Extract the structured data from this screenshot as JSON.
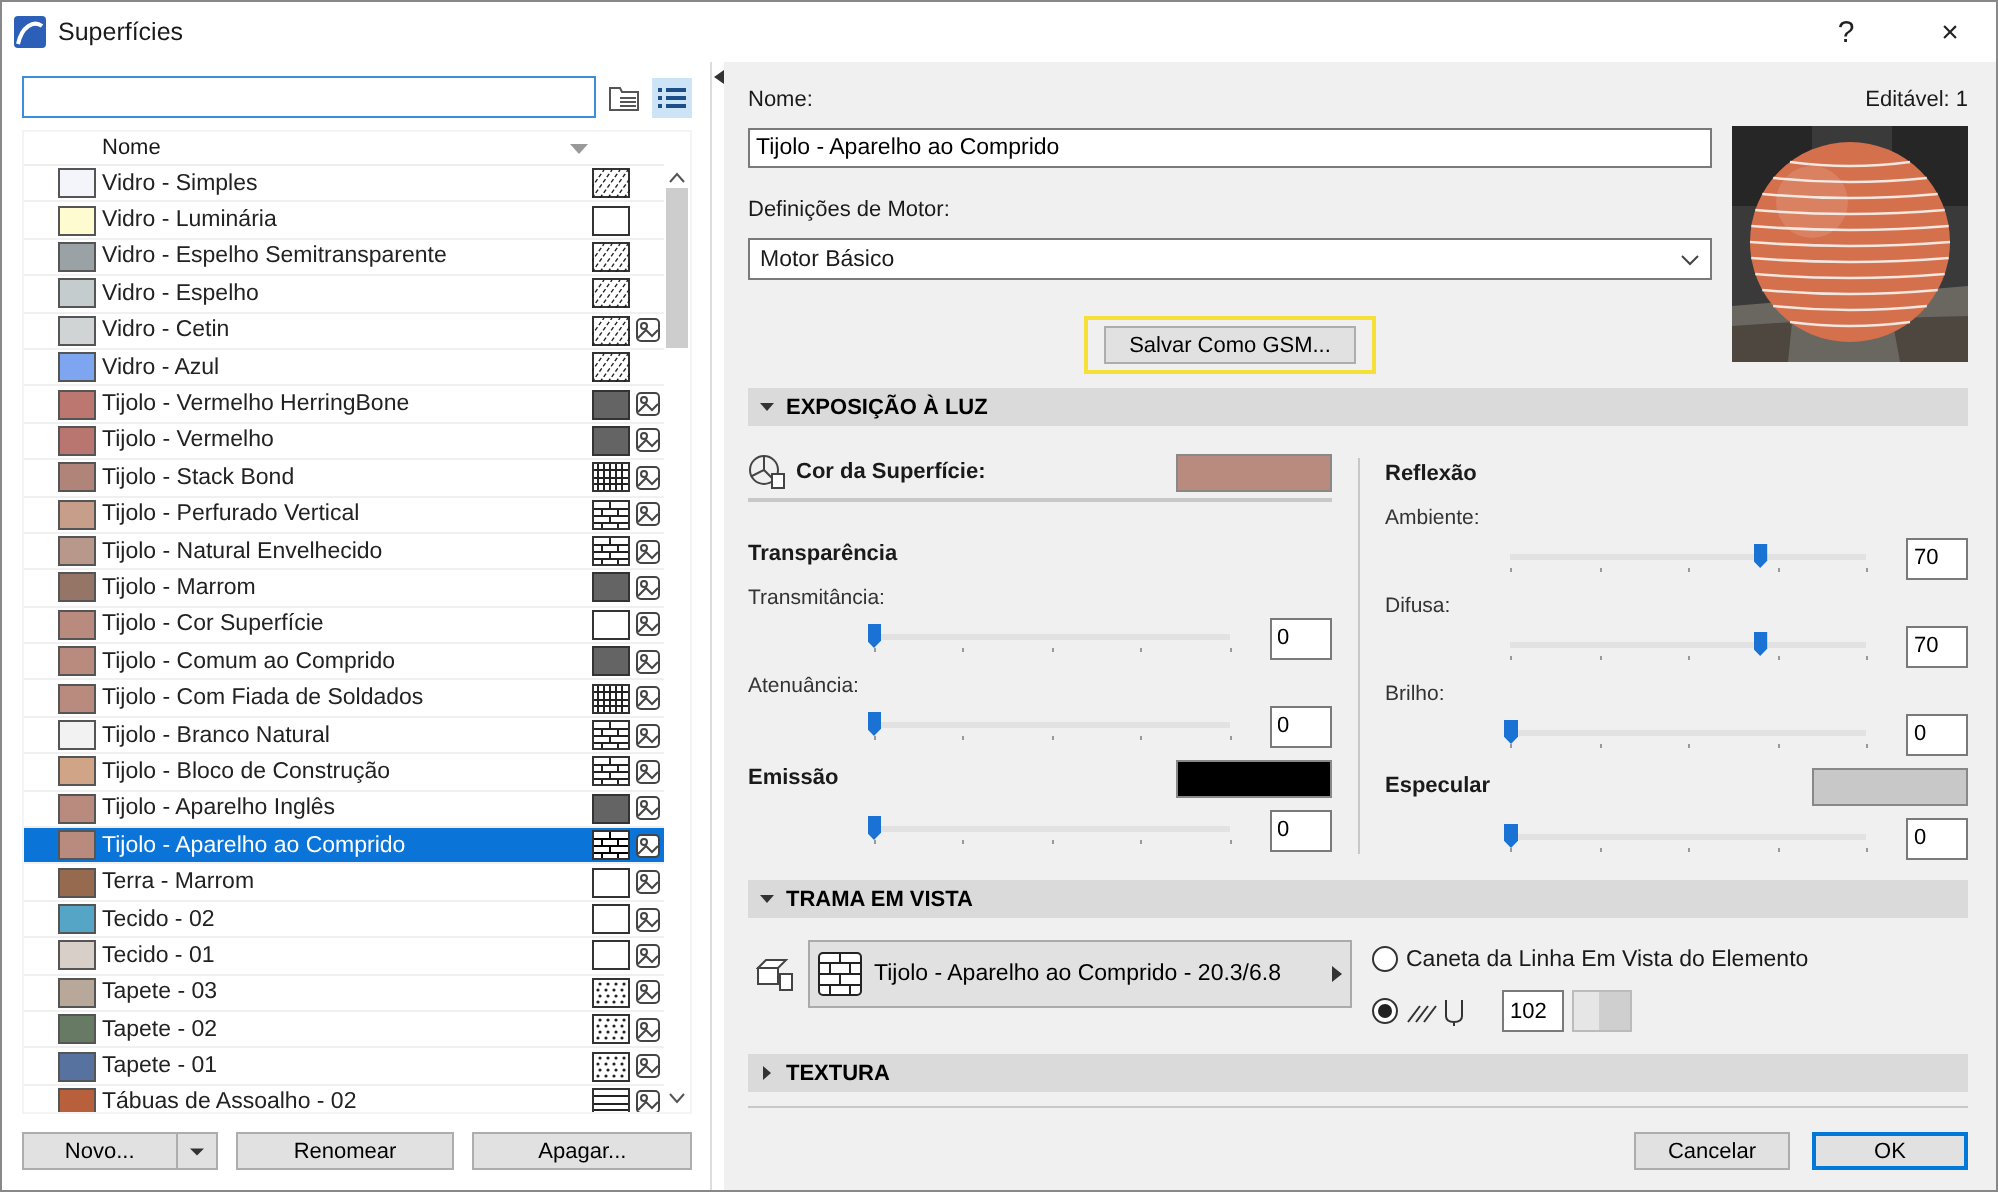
{
  "window": {
    "title": "Superfícies",
    "buttons": [
      "?",
      "×"
    ]
  },
  "library": {
    "view_buttons": [
      {
        "kind": "folder",
        "selected": false
      },
      {
        "kind": "list",
        "selected": true
      }
    ],
    "column": "Nome",
    "rows": [
      {
        "name": "Vidro - Simples",
        "color": "#f4f4fb",
        "kind": "diagonal",
        "texture": false,
        "selected": false
      },
      {
        "name": "Vidro - Luminária",
        "color": "#fffbd0",
        "kind": "blank",
        "texture": false,
        "selected": false
      },
      {
        "name": "Vidro - Espelho Semitransparente",
        "color": "#9aa2a6",
        "kind": "diagonal",
        "texture": false,
        "selected": false
      },
      {
        "name": "Vidro - Espelho",
        "color": "#c5ccce",
        "kind": "diagonal",
        "texture": false,
        "selected": false
      },
      {
        "name": "Vidro - Cetin",
        "color": "#d0d4d4",
        "kind": "diagonal",
        "texture": true,
        "selected": false
      },
      {
        "name": "Vidro - Azul",
        "color": "#7ea5ef",
        "kind": "diagonal",
        "texture": false,
        "selected": false
      },
      {
        "name": "Tijolo - Vermelho HerringBone",
        "color": "#bc7770",
        "kind": "dense",
        "texture": true,
        "selected": false
      },
      {
        "name": "Tijolo - Vermelho",
        "color": "#b97670",
        "kind": "dense",
        "texture": true,
        "selected": false
      },
      {
        "name": "Tijolo - Stack Bond",
        "color": "#b08478",
        "kind": "grid",
        "texture": true,
        "selected": false
      },
      {
        "name": "Tijolo - Perfurado Vertical",
        "color": "#c69e8a",
        "kind": "brick",
        "texture": true,
        "selected": false
      },
      {
        "name": "Tijolo - Natural Envelhecido",
        "color": "#b8988a",
        "kind": "brick",
        "texture": true,
        "selected": false
      },
      {
        "name": "Tijolo - Marrom",
        "color": "#957566",
        "kind": "dense",
        "texture": true,
        "selected": false
      },
      {
        "name": "Tijolo - Cor Superfície",
        "color": "#b98a7e",
        "kind": "blank",
        "texture": true,
        "selected": false
      },
      {
        "name": "Tijolo - Comum ao Comprido",
        "color": "#b98a7e",
        "kind": "dense",
        "texture": true,
        "selected": false
      },
      {
        "name": "Tijolo - Com Fiada de Soldados",
        "color": "#b98a7e",
        "kind": "grid",
        "texture": true,
        "selected": false
      },
      {
        "name": "Tijolo - Branco Natural",
        "color": "#f2f2f2",
        "kind": "brick",
        "texture": true,
        "selected": false
      },
      {
        "name": "Tijolo - Bloco de Construção",
        "color": "#d0a587",
        "kind": "brick",
        "texture": true,
        "selected": false
      },
      {
        "name": "Tijolo - Aparelho Inglês",
        "color": "#b98a7e",
        "kind": "dense",
        "texture": true,
        "selected": false
      },
      {
        "name": "Tijolo - Aparelho ao Comprido",
        "color": "#b98a7e",
        "kind": "brick",
        "texture": true,
        "selected": true
      },
      {
        "name": "Terra - Marrom",
        "color": "#966a4f",
        "kind": "blank",
        "texture": true,
        "selected": false
      },
      {
        "name": "Tecido - 02",
        "color": "#55a6c6",
        "kind": "blank",
        "texture": true,
        "selected": false
      },
      {
        "name": "Tecido - 01",
        "color": "#d8cfc8",
        "kind": "blank",
        "texture": true,
        "selected": false
      },
      {
        "name": "Tapete - 03",
        "color": "#b8a89a",
        "kind": "dots",
        "texture": true,
        "selected": false
      },
      {
        "name": "Tapete - 02",
        "color": "#667a64",
        "kind": "dots",
        "texture": true,
        "selected": false
      },
      {
        "name": "Tapete - 01",
        "color": "#5872a0",
        "kind": "dots",
        "texture": true,
        "selected": false
      },
      {
        "name": "Tábuas de Assoalho - 02",
        "color": "#b8603c",
        "kind": "lines",
        "texture": true,
        "selected": false
      }
    ],
    "buttons": [
      "Novo...",
      "Renomear",
      "Apagar..."
    ]
  },
  "details": {
    "name_label": "Nome:",
    "editable": "Editável: 1",
    "name_value": "Tijolo - Aparelho ao Comprido",
    "engine_label": "Definições de Motor:",
    "engine_value": "Motor Básico",
    "save_gsm": "Salvar Como GSM...",
    "light": {
      "title": "EXPOSIÇÃO À LUZ",
      "expanded": true,
      "left": [
        {
          "kind": "surface",
          "label": "Cor da Superfície:",
          "color": "#b98a7e"
        },
        {
          "kind": "heading",
          "label": "Transparência"
        },
        {
          "kind": "slider",
          "label": "Transmitância:",
          "level": 0,
          "value": "0"
        },
        {
          "kind": "slider",
          "label": "Atenuância:",
          "level": 0,
          "value": "0"
        },
        {
          "kind": "color",
          "label": "Emissão",
          "color": "#000000"
        },
        {
          "kind": "slider",
          "level": 0,
          "value": "0"
        }
      ],
      "right": [
        {
          "kind": "heading",
          "label": "Reflexão"
        },
        {
          "kind": "slider",
          "label": "Ambiente:",
          "level": 0.7,
          "value": "70"
        },
        {
          "kind": "slider",
          "label": "Difusa:",
          "level": 0.7,
          "value": "70"
        },
        {
          "kind": "slider",
          "label": "Brilho:",
          "level": 0,
          "value": "0"
        },
        {
          "kind": "color",
          "label": "Especular",
          "color": "#c8c8c8"
        },
        {
          "kind": "slider",
          "level": 0,
          "value": "0"
        }
      ]
    },
    "hatch": {
      "title": "TRAMA EM VISTA",
      "expanded": true,
      "pattern": "Tijolo - Aparelho ao Comprido - 20.3/6.8",
      "options": [
        {
          "kind": "label",
          "label": "Caneta da Linha Em Vista do Elemento",
          "selected": false
        },
        {
          "kind": "pen",
          "value": "102",
          "selected": true
        }
      ]
    },
    "texture": {
      "title": "TEXTURA",
      "expanded": false
    }
  },
  "footer": {
    "cancel": "Cancelar",
    "ok": "OK"
  }
}
